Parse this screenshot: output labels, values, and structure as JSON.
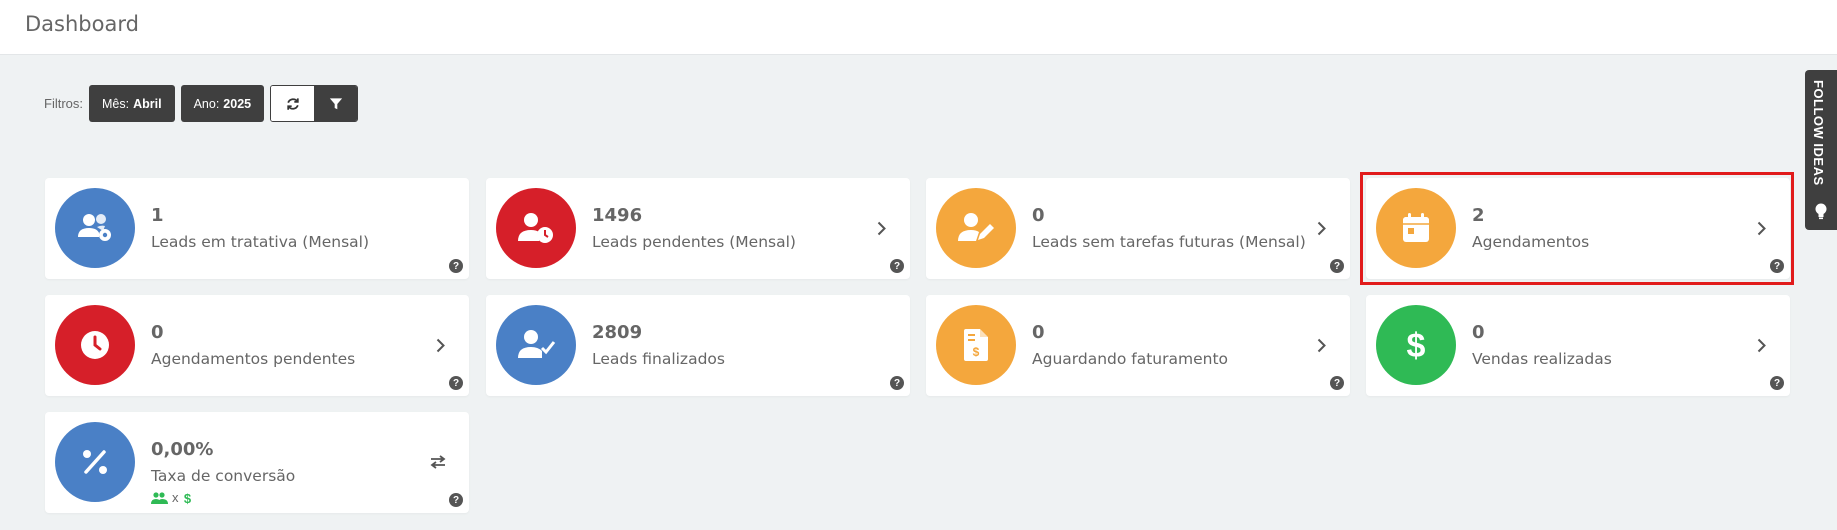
{
  "header": {
    "title": "Dashboard"
  },
  "filters": {
    "label": "Filtros:",
    "month_label": "Mês:",
    "month_value": "Abril",
    "year_label": "Ano:",
    "year_value": "2025"
  },
  "side_tab": {
    "label": "FOLLOW IDEAS"
  },
  "colors": {
    "blue": "#4a80c6",
    "red": "#d61f29",
    "orange": "#f4a73d",
    "green": "#2fba55",
    "dark": "#3f3f3f",
    "highlight": "#e11b1b"
  },
  "cards": [
    {
      "value": "1",
      "label": "Leads em tratativa (Mensal)",
      "icon": "users-gear-icon",
      "color": "blue",
      "action": "none"
    },
    {
      "value": "1496",
      "label": "Leads pendentes (Mensal)",
      "icon": "user-clock-icon",
      "color": "red",
      "action": "chevron-right-icon"
    },
    {
      "value": "0",
      "label": "Leads sem tarefas futuras (Mensal)",
      "icon": "user-pen-icon",
      "color": "orange",
      "action": "chevron-right-icon"
    },
    {
      "value": "2",
      "label": "Agendamentos",
      "icon": "calendar-icon",
      "color": "orange",
      "action": "chevron-right-icon",
      "highlighted": true
    },
    {
      "value": "0",
      "label": "Agendamentos pendentes",
      "icon": "clock-icon",
      "color": "red",
      "action": "chevron-right-icon"
    },
    {
      "value": "2809",
      "label": "Leads finalizados",
      "icon": "user-check-icon",
      "color": "blue",
      "action": "none"
    },
    {
      "value": "0",
      "label": "Aguardando faturamento",
      "icon": "invoice-dollar-icon",
      "color": "orange",
      "action": "chevron-right-icon"
    },
    {
      "value": "0",
      "label": "Vendas realizadas",
      "icon": "dollar-icon",
      "color": "green",
      "action": "chevron-right-icon"
    },
    {
      "value": "0,00%",
      "label": "Taxa de conversão",
      "icon": "percent-icon",
      "color": "blue",
      "action": "exchange-icon",
      "sub_separator": "x"
    }
  ]
}
